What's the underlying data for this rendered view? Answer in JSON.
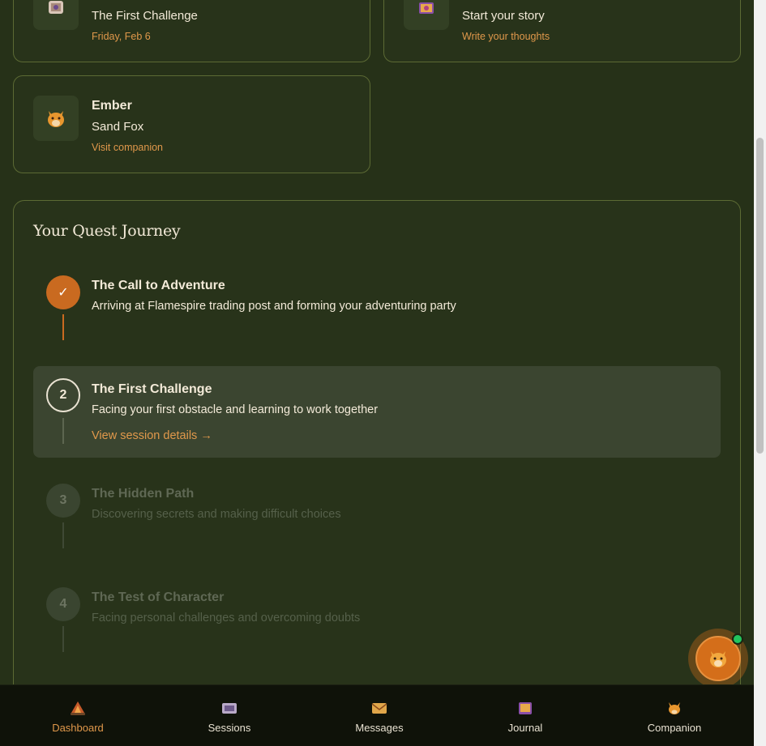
{
  "cards": {
    "session": {
      "title": "The First Challenge",
      "subtitle": "Friday, Feb 6",
      "icon": "scroll-icon"
    },
    "journal": {
      "title": "Start your story",
      "subtitle": "Write your thoughts",
      "icon": "book-icon"
    },
    "companion": {
      "name": "Ember",
      "species": "Sand Fox",
      "link": "Visit companion",
      "icon": "fox-icon"
    }
  },
  "journey": {
    "heading": "Your Quest Journey",
    "steps": [
      {
        "marker": "✓",
        "title": "The Call to Adventure",
        "description": "Arriving at Flamespire trading post and forming your adventuring party",
        "state": "completed"
      },
      {
        "marker": "2",
        "title": "The First Challenge",
        "description": "Facing your first obstacle and learning to work together",
        "link": "View session details →",
        "state": "current"
      },
      {
        "marker": "3",
        "title": "The Hidden Path",
        "description": "Discovering secrets and making difficult choices",
        "state": "locked"
      },
      {
        "marker": "4",
        "title": "The Test of Character",
        "description": "Facing personal challenges and overcoming doubts",
        "state": "locked"
      }
    ]
  },
  "nav": {
    "items": [
      {
        "label": "Dashboard",
        "icon": "campfire-icon",
        "active": true
      },
      {
        "label": "Sessions",
        "icon": "scroll-icon",
        "active": false
      },
      {
        "label": "Messages",
        "icon": "envelope-icon",
        "active": false
      },
      {
        "label": "Journal",
        "icon": "book-icon",
        "active": false
      },
      {
        "label": "Companion",
        "icon": "fox-icon",
        "active": false
      }
    ]
  },
  "colors": {
    "background": "#263118",
    "accent": "#e0984b",
    "completed": "#c96a20",
    "online": "#22c55e"
  }
}
